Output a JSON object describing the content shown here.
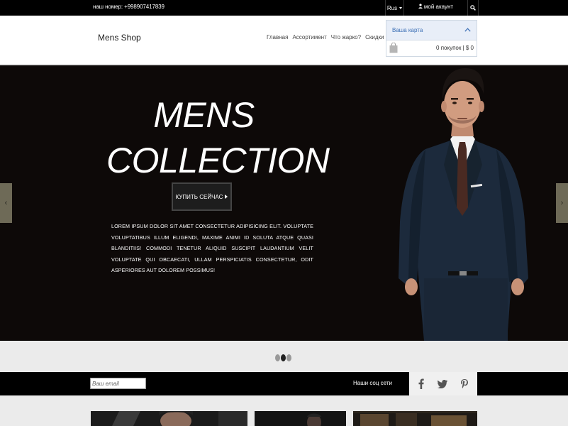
{
  "topbar": {
    "phone": "наш номер: +998907417839",
    "language": "Rus",
    "account": "мой акаунт",
    "icons": {
      "search": "search-icon",
      "user": "user-icon",
      "language_caret": "caret-down-icon"
    }
  },
  "header": {
    "logo": "Mens Shop",
    "nav": [
      {
        "label": "Главная"
      },
      {
        "label": "Ассортимент"
      },
      {
        "label": "Что жарко?"
      },
      {
        "label": "Скидки"
      }
    ],
    "cart": {
      "title": "Ваша карта",
      "summary": "0 покупок | $ 0",
      "icons": {
        "toggle": "chevron-up-icon",
        "bag": "shopping-bag-icon"
      }
    }
  },
  "hero": {
    "title_line1": "MENS",
    "title_line2": "COLLECTION",
    "button_label": "КУПИТЬ СЕЙЧАС",
    "description": "LOREM IPSUM DOLOR SIT AMET CONSECTETUR ADIPISICING ELIT. VOLUPTATE VOLUPTATIBUS ILLUM ELIGENDI, MAXIME ANIMI ID SOLUTA ATQUE QUASI BLANDITIIS! COMMODI TENETUR ALIQUID SUSCIPIT LAUDANTIUM VELIT VOLUPTATE QUI OBCAECATI, ULLAM PERSPICIATIS CONSECTETUR, ODIT ASPERIORES AUT DOLOREM POSSIMUS!",
    "prev_arrow": "‹",
    "next_arrow": "›",
    "slides_count": 3,
    "active_slide": 2
  },
  "footer_bar": {
    "email_placeholder": "Ваш email",
    "social_label": "Наши соц сети",
    "social_icons": [
      "facebook-icon",
      "twitter-icon",
      "pinterest-icon"
    ]
  },
  "colors": {
    "topbar_bg": "#000000",
    "hero_bg": "#0d0908",
    "cart_title": "#3b6fb5",
    "arrow_bg": "#6e6a57"
  }
}
